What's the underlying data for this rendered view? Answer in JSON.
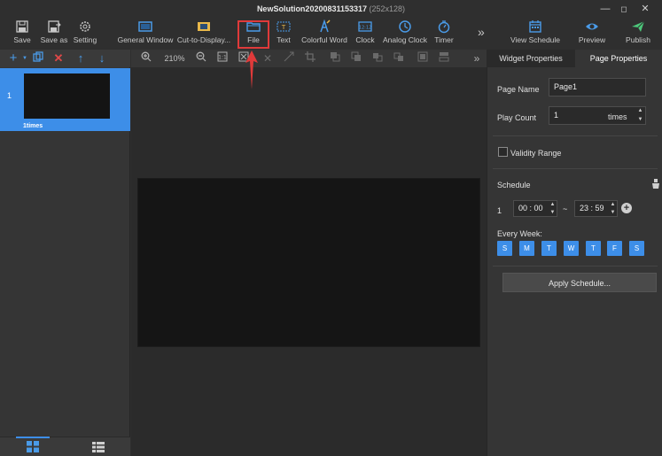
{
  "title": {
    "name": "NewSolution20200831153317",
    "size": "(252x128)"
  },
  "window_controls": {
    "minimize": "—",
    "maximize": "◻",
    "close": "✕"
  },
  "toolbar": {
    "save": "Save",
    "save_as": "Save as",
    "setting": "Setting",
    "general_window": "General Window",
    "cut_to_display": "Cut-to-Display...",
    "file": "File",
    "text": "Text",
    "colorful_word": "Colorful Word",
    "clock": "Clock",
    "analog_clock": "Analog Clock",
    "timer": "Timer",
    "more": "»",
    "view_schedule": "View Schedule",
    "preview": "Preview",
    "publish": "Publish"
  },
  "left_panel": {
    "pages": [
      {
        "number": "1",
        "play_count": "1times"
      }
    ]
  },
  "editor": {
    "zoom": "210%",
    "more": "»"
  },
  "right_panel": {
    "tabs": {
      "widget": "Widget Properties",
      "page": "Page Properties"
    },
    "page_name_label": "Page Name",
    "page_name_value": "Page1",
    "play_count_label": "Play Count",
    "play_count_value": "1",
    "play_count_unit": "times",
    "validity_label": "Validity Range",
    "schedule_label": "Schedule",
    "schedule_row": "1",
    "start_time": "00 : 00",
    "tilde": "~",
    "end_time": "23 : 59",
    "every_week_label": "Every Week:",
    "days": [
      "S",
      "M",
      "T",
      "W",
      "T",
      "F",
      "S"
    ],
    "apply_button": "Apply Schedule..."
  },
  "colors": {
    "accent": "#3d8ee8",
    "highlight": "#e03a3a",
    "background": "#2f2f2f"
  }
}
